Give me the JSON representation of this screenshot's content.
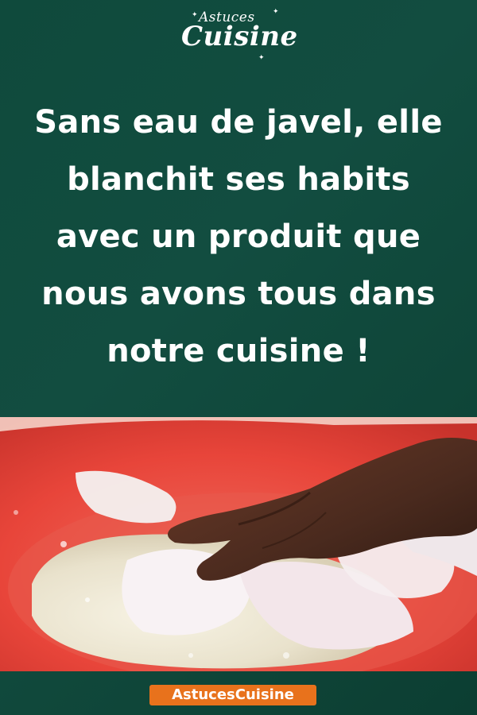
{
  "logo": {
    "top_word": "Astuces",
    "main_word": "Cuisine"
  },
  "headline": {
    "lines": [
      "Sans eau de javel, elle",
      "blanchit ses habits",
      "avec un produit que",
      "nous avons tous dans",
      "notre cuisine !"
    ]
  },
  "photo": {
    "icon": "laundry-basin-photo",
    "colors": {
      "basin": "#e8453a",
      "foam": "#f1f1e8",
      "skin": "#4a2a1e"
    }
  },
  "footer": {
    "badge_text": "AstucesCuisine",
    "badge_color": "#e8721c"
  }
}
